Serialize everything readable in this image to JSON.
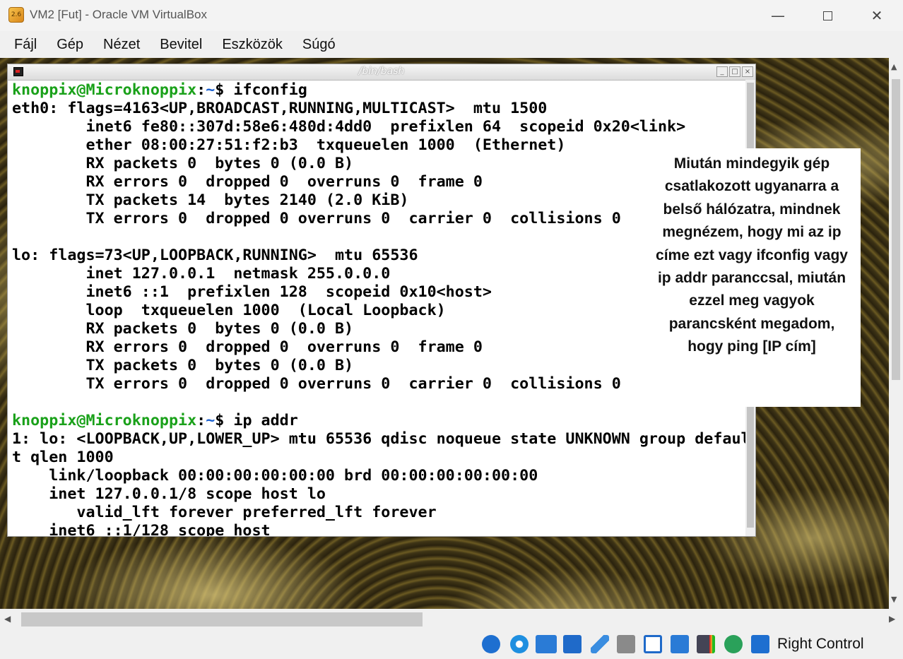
{
  "window": {
    "title": "VM2 [Fut] - Oracle VM VirtualBox",
    "app_icon_label": "2.6",
    "minimize_glyph": "—",
    "close_glyph": "✕"
  },
  "menu": [
    "Fájl",
    "Gép",
    "Nézet",
    "Bevitel",
    "Eszközök",
    "Súgó"
  ],
  "terminal": {
    "title": "/bin/bash",
    "prompt_user": "knoppix@Microknoppix",
    "prompt_sep": ":",
    "prompt_path": "~",
    "prompt_sym": "$ ",
    "lines": [
      {
        "prompt": true,
        "text": "ifconfig"
      },
      {
        "text": "eth0: flags=4163<UP,BROADCAST,RUNNING,MULTICAST>  mtu 1500"
      },
      {
        "text": "        inet6 fe80::307d:58e6:480d:4dd0  prefixlen 64  scopeid 0x20<link>"
      },
      {
        "text": "        ether 08:00:27:51:f2:b3  txqueuelen 1000  (Ethernet)"
      },
      {
        "text": "        RX packets 0  bytes 0 (0.0 B)"
      },
      {
        "text": "        RX errors 0  dropped 0  overruns 0  frame 0"
      },
      {
        "text": "        TX packets 14  bytes 2140 (2.0 KiB)"
      },
      {
        "text": "        TX errors 0  dropped 0 overruns 0  carrier 0  collisions 0"
      },
      {
        "text": ""
      },
      {
        "text": "lo: flags=73<UP,LOOPBACK,RUNNING>  mtu 65536"
      },
      {
        "text": "        inet 127.0.0.1  netmask 255.0.0.0"
      },
      {
        "text": "        inet6 ::1  prefixlen 128  scopeid 0x10<host>"
      },
      {
        "text": "        loop  txqueuelen 1000  (Local Loopback)"
      },
      {
        "text": "        RX packets 0  bytes 0 (0.0 B)"
      },
      {
        "text": "        RX errors 0  dropped 0  overruns 0  frame 0"
      },
      {
        "text": "        TX packets 0  bytes 0 (0.0 B)"
      },
      {
        "text": "        TX errors 0  dropped 0 overruns 0  carrier 0  collisions 0"
      },
      {
        "text": ""
      },
      {
        "prompt": true,
        "text": "ip addr"
      },
      {
        "text": "1: lo: <LOOPBACK,UP,LOWER_UP> mtu 65536 qdisc noqueue state UNKNOWN group defaul"
      },
      {
        "text": "t qlen 1000"
      },
      {
        "text": "    link/loopback 00:00:00:00:00:00 brd 00:00:00:00:00:00"
      },
      {
        "text": "    inet 127.0.0.1/8 scope host lo"
      },
      {
        "text": "       valid_lft forever preferred_lft forever"
      },
      {
        "text": "    inet6 ::1/128 scope host"
      }
    ]
  },
  "note": {
    "lines": [
      "Miután mindegyik gép",
      "csatlakozott ugyanarra a",
      "belső hálózatra, mindnek",
      "megnézem, hogy mi az ip",
      "címe ezt vagy ifconfig vagy",
      "ip addr paranccsal, miután",
      "ezzel meg vagyok",
      "parancsként megadom,",
      "hogy ping [IP cím]"
    ]
  },
  "statusbar": {
    "host_key": "Right Control",
    "icons": [
      "hard-disk-icon",
      "optical-drive-icon",
      "audio-icon",
      "network-icon",
      "usb-icon",
      "shared-folders-icon",
      "display-icon",
      "video-capture-icon",
      "virtualization-icon",
      "mouse-integration-icon",
      "keyboard-capture-icon"
    ]
  },
  "colors": {
    "prompt_user": "#1aa11a",
    "prompt_path": "#1a60d0",
    "accent_blue": "#1e6fd0"
  }
}
